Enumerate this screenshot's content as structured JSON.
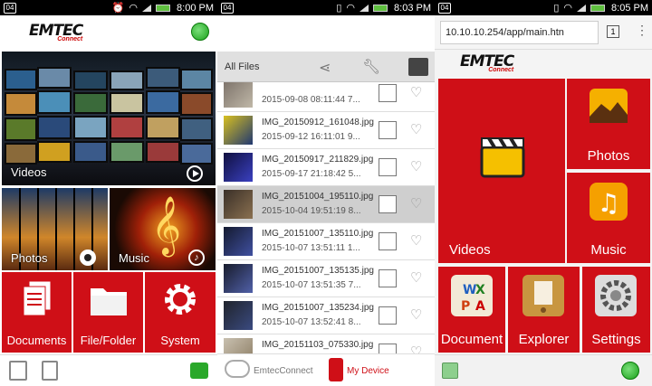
{
  "screen1": {
    "status": {
      "badge": "04",
      "time": "8:00 PM"
    },
    "logo": {
      "main": "EMTEC",
      "sub": "Connect"
    },
    "tiles": {
      "videos": "Videos",
      "photos": "Photos",
      "music": "Music",
      "documents": "Documents",
      "file_folder": "File/Folder",
      "system": "System"
    }
  },
  "screen2": {
    "status": {
      "badge": "04",
      "time": "8:03 PM"
    },
    "header": {
      "title": "All Files"
    },
    "files": [
      {
        "name": "",
        "meta": "2015-09-08 08:11:44   7...",
        "selected": false
      },
      {
        "name": "IMG_20150912_161048.jpg",
        "meta": "2015-09-12 16:11:01   9...",
        "selected": false
      },
      {
        "name": "IMG_20150917_211829.jpg",
        "meta": "2015-09-17 21:18:42   5...",
        "selected": false
      },
      {
        "name": "IMG_20151004_195110.jpg",
        "meta": "2015-10-04 19:51:19   8...",
        "selected": true
      },
      {
        "name": "IMG_20151007_135110.jpg",
        "meta": "2015-10-07 13:51:11   1...",
        "selected": false
      },
      {
        "name": "IMG_20151007_135135.jpg",
        "meta": "2015-10-07 13:51:35   7...",
        "selected": false
      },
      {
        "name": "IMG_20151007_135234.jpg",
        "meta": "2015-10-07 13:52:41   8...",
        "selected": false
      },
      {
        "name": "IMG_20151103_075330.jpg",
        "meta": "2015-11-03 07:53:31   6...",
        "selected": false
      }
    ],
    "tabs": {
      "cloud": "EmtecConnect",
      "device": "My Device"
    }
  },
  "screen3": {
    "status": {
      "badge": "04",
      "time": "8:05 PM"
    },
    "url": "10.10.10.254/app/main.htn",
    "tab_count": "1",
    "logo": {
      "main": "EMTEC",
      "sub": "Connect"
    },
    "tiles": {
      "videos": "Videos",
      "photos": "Photos",
      "music": "Music",
      "documents": "Document",
      "explorer": "Explorer",
      "settings": "Settings"
    }
  },
  "colors": {
    "brand_red": "#cf0f17",
    "accent_green": "#1aa01a"
  }
}
